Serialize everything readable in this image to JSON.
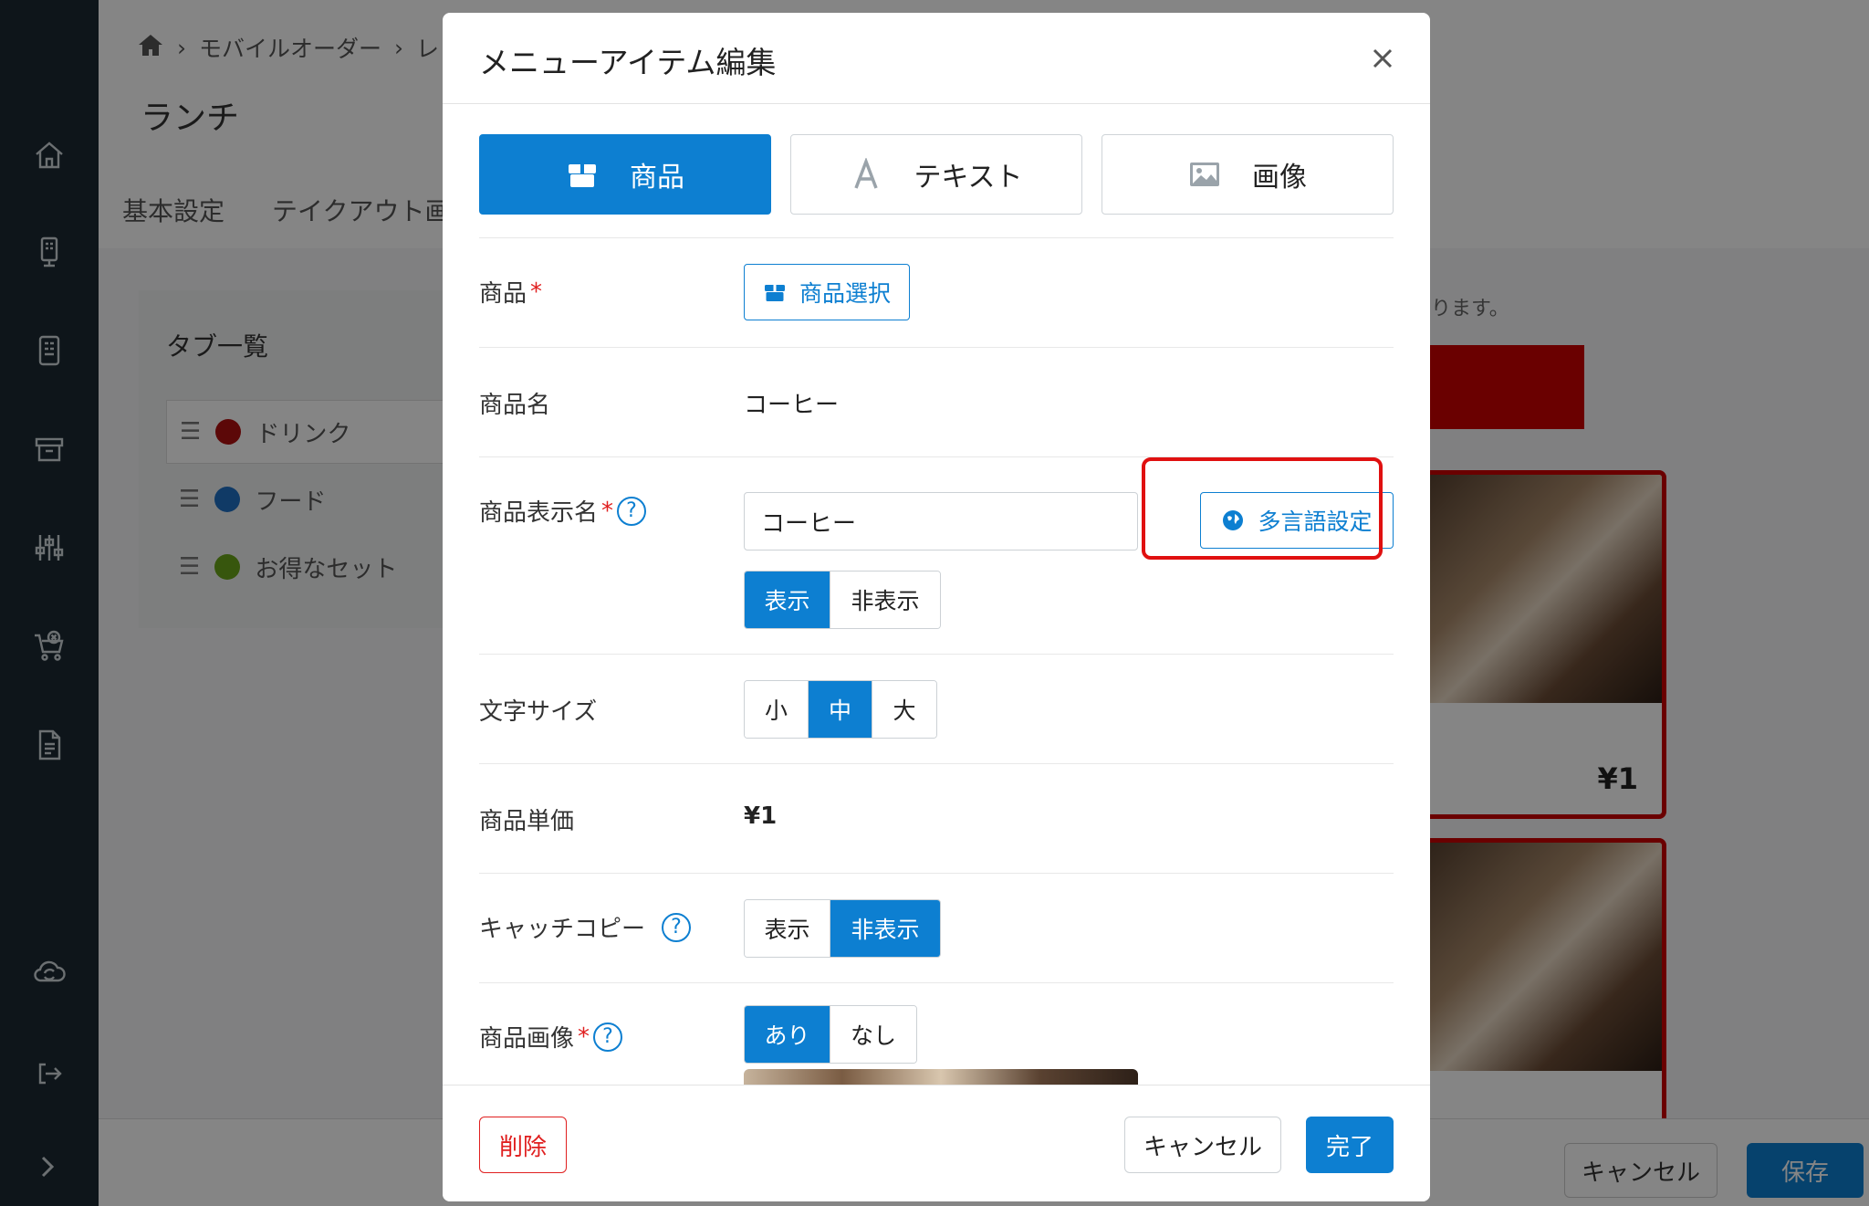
{
  "background": {
    "breadcrumb": [
      "モバイルオーダー",
      "レ"
    ],
    "page_title": "ランチ",
    "tabs": [
      "基本設定",
      "テイクアウト画"
    ],
    "tab_list_title": "タブ一覧",
    "tab_items": [
      {
        "label": "ドリンク",
        "color": "#b01010"
      },
      {
        "label": "フード",
        "color": "#1f6fc4"
      },
      {
        "label": "お得なセット",
        "color": "#6aa519"
      }
    ],
    "note_fragment": "ります。",
    "card_price": "¥1",
    "footer": {
      "cancel": "キャンセル",
      "save": "保存"
    }
  },
  "modal": {
    "title": "メニューアイテム編集",
    "type_tabs": [
      {
        "label": "商品",
        "icon": "box-icon",
        "active": true
      },
      {
        "label": "テキスト",
        "icon": "text-a-icon",
        "active": false
      },
      {
        "label": "画像",
        "icon": "image-icon",
        "active": false
      }
    ],
    "fields": {
      "product": {
        "label": "商品",
        "required": "*",
        "button": "商品選択"
      },
      "product_name": {
        "label": "商品名",
        "value": "コーヒー"
      },
      "display_name": {
        "label": "商品表示名",
        "required": "*",
        "help": "?",
        "value": "コーヒー",
        "multilang_button": "多言語設定",
        "visibility": [
          "表示",
          "非表示"
        ],
        "visibility_selected": "表示"
      },
      "font_size": {
        "label": "文字サイズ",
        "options": [
          "小",
          "中",
          "大"
        ],
        "selected": "中"
      },
      "unit_price": {
        "label": "商品単価",
        "value": "¥1"
      },
      "catch_copy": {
        "label": "キャッチコピー",
        "help": "?",
        "options": [
          "表示",
          "非表示"
        ],
        "selected": "非表示"
      },
      "product_image": {
        "label": "商品画像",
        "required": "*",
        "help": "?",
        "options": [
          "あり",
          "なし"
        ],
        "selected": "あり"
      }
    },
    "footer": {
      "delete": "削除",
      "cancel": "キャンセル",
      "done": "完了"
    }
  },
  "colors": {
    "primary": "#0d7fd1",
    "danger": "#e02020",
    "sidebar": "#1b2a33"
  }
}
